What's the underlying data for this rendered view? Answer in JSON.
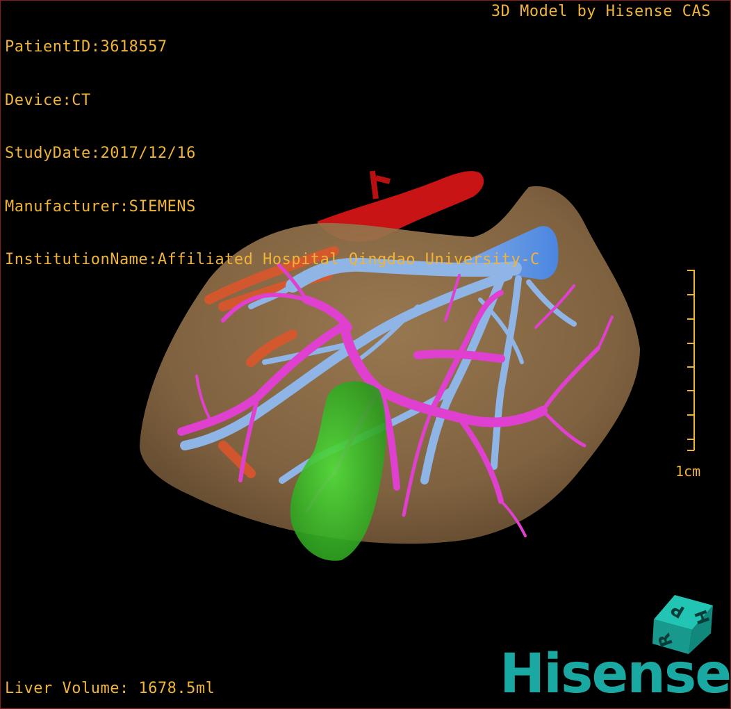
{
  "header": {
    "patient_id": "PatientID:3618557",
    "device": "Device:CT",
    "study_date": "StudyDate:2017/12/16",
    "manufacturer": "Manufacturer:SIEMENS",
    "institution": "InstitutionName:Affiliated Hospital Qingdao University-C"
  },
  "brand_note": "3D Model by Hisense CAS",
  "footer": {
    "liver_volume": "Liver Volume: 1678.5ml"
  },
  "scale_bar": {
    "unit_label": "1cm"
  },
  "orientation_cube": {
    "labels": [
      "H",
      "P",
      "R"
    ]
  },
  "logo": {
    "text": "Hisense"
  },
  "colors": {
    "overlay_text": "#f0b43a",
    "liver": "#8a6a45",
    "portal_vein": "#e040d0",
    "hepatic_vein": "#8fb4e6",
    "artery_aorta": "#c81414",
    "gallbladder": "#3fc22a",
    "brand": "#1aa9a2"
  }
}
